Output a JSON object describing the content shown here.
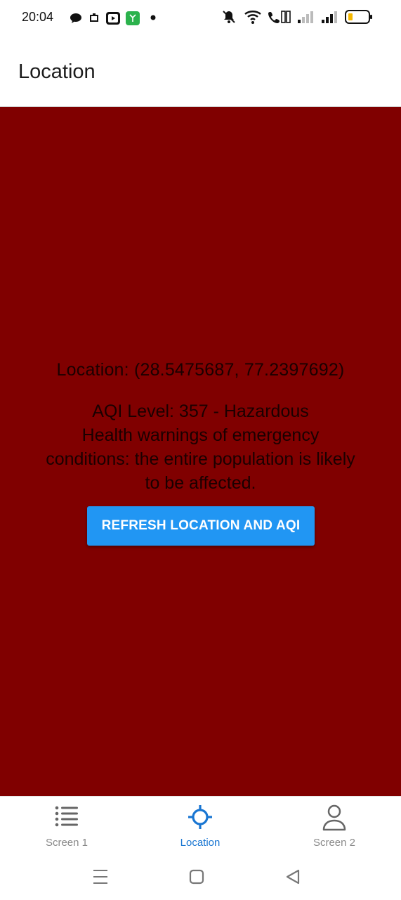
{
  "status_bar": {
    "time": "20:04",
    "battery_color": "#f5b800"
  },
  "header": {
    "title": "Location"
  },
  "main": {
    "background_color": "#800000",
    "location_text": "Location: (28.5475687, 77.2397692)",
    "aqi_line": "AQI Level: 357 - Hazardous",
    "health_warning": "Health warnings of emergency conditions: the entire population is likely to be affected.",
    "refresh_button_label": "REFRESH LOCATION AND AQI",
    "button_color": "#2196f3"
  },
  "tab_bar": {
    "tabs": [
      {
        "label": "Screen 1",
        "icon": "list-icon",
        "active": false
      },
      {
        "label": "Location",
        "icon": "crosshair-icon",
        "active": true
      },
      {
        "label": "Screen 2",
        "icon": "person-icon",
        "active": false
      }
    ],
    "active_color": "#1976d2",
    "inactive_color": "#8a8a8a"
  },
  "nav_bar": {
    "buttons": [
      "menu-icon",
      "home-icon",
      "back-icon"
    ]
  }
}
